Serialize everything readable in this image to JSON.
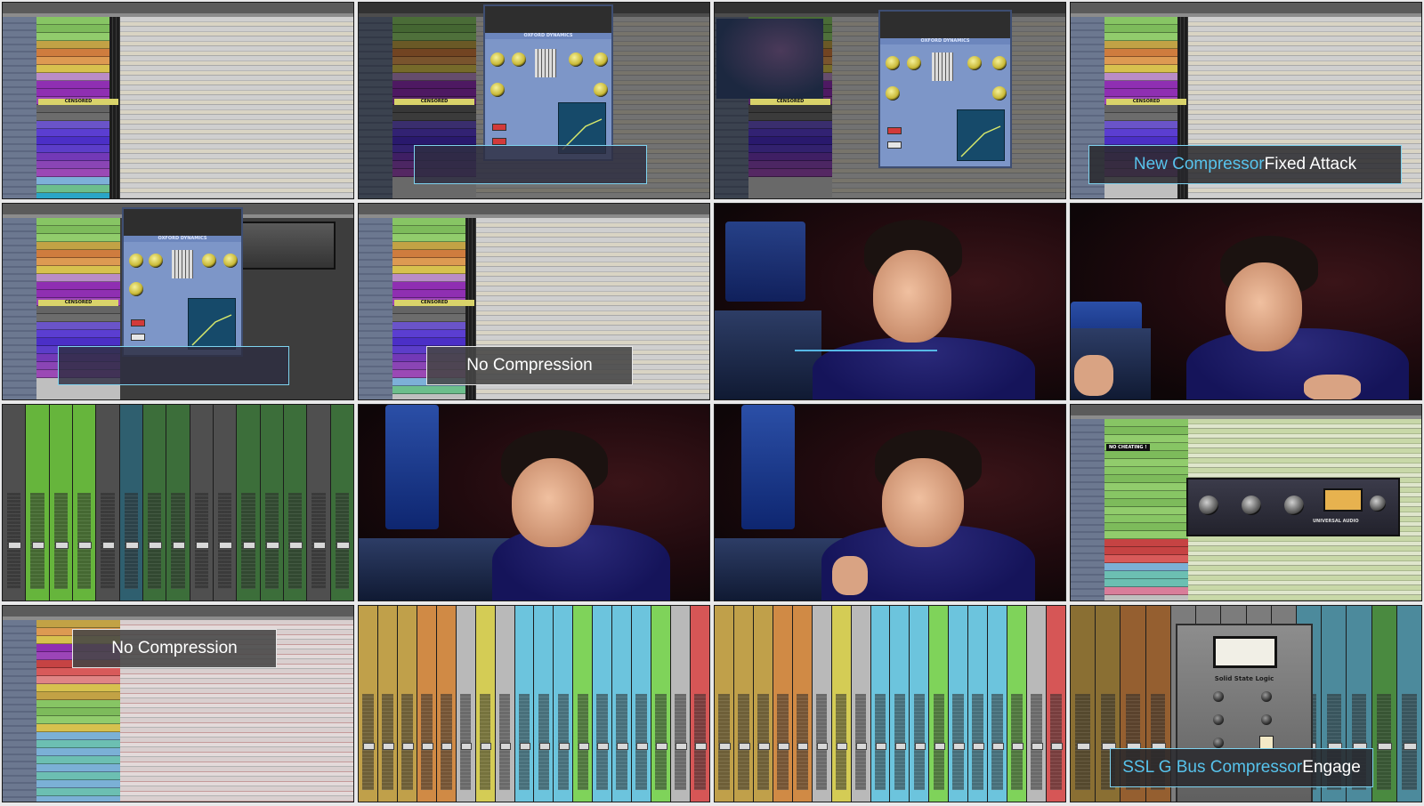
{
  "tiles": [
    {
      "id": "t1",
      "kind": "edit"
    },
    {
      "id": "t2",
      "kind": "edit-plugin",
      "caption": ""
    },
    {
      "id": "t3",
      "kind": "edit-plugin-person"
    },
    {
      "id": "t4",
      "kind": "edit",
      "caption": {
        "highlight": "New Compressor",
        "rest": " Fixed Attack"
      }
    },
    {
      "id": "t5",
      "kind": "edit-plugin",
      "caption": ""
    },
    {
      "id": "t6",
      "kind": "edit",
      "caption": {
        "text": "No Compression"
      }
    },
    {
      "id": "t7",
      "kind": "person"
    },
    {
      "id": "t8",
      "kind": "person"
    },
    {
      "id": "t9",
      "kind": "mixer-green"
    },
    {
      "id": "t10",
      "kind": "person"
    },
    {
      "id": "t11",
      "kind": "person"
    },
    {
      "id": "t12",
      "kind": "edit-uad"
    },
    {
      "id": "t13",
      "kind": "edit",
      "caption": {
        "text": "No Compression"
      }
    },
    {
      "id": "t14",
      "kind": "mixer-color"
    },
    {
      "id": "t15",
      "kind": "mixer-color"
    },
    {
      "id": "t16",
      "kind": "mixer-ssl",
      "caption": {
        "highlight": "SSL G Bus Compressor",
        "rest": " Engage"
      }
    }
  ],
  "labels": {
    "censored": "CENSORED",
    "plugin_title": "OXFORD DYNAMICS",
    "plugin_brand": "Sonnox",
    "no_cheating": "NO CHEATING !",
    "ssl_name": "Solid State Logic",
    "uad_brand": "UNIVERSAL AUDIO"
  },
  "colors": {
    "caption_highlight": "#57c3ec",
    "caption_border": "#7fd3ef"
  }
}
